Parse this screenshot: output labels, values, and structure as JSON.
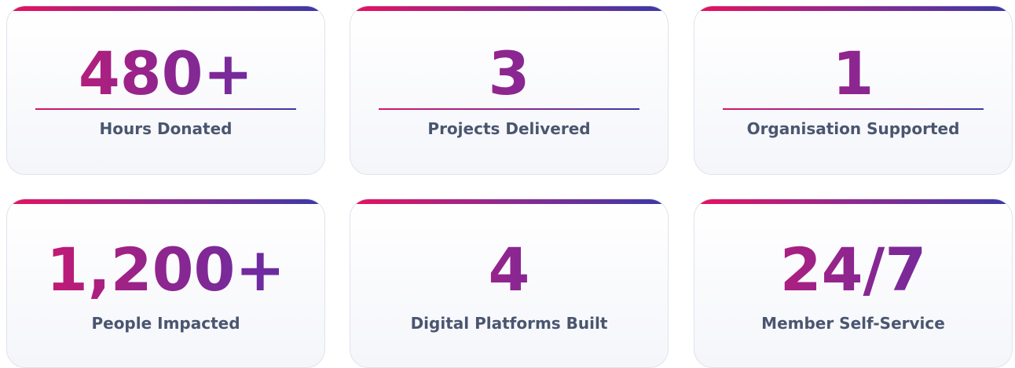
{
  "stats": [
    {
      "value": "480+",
      "label": "Hours Donated",
      "has_divider": true
    },
    {
      "value": "3",
      "label": "Projects Delivered",
      "has_divider": true
    },
    {
      "value": "1",
      "label": "Organisation Supported",
      "has_divider": true
    },
    {
      "value": "1,200+",
      "label": "People Impacted",
      "has_divider": false
    },
    {
      "value": "4",
      "label": "Digital Platforms Built",
      "has_divider": false
    },
    {
      "value": "24/7",
      "label": "Member Self-Service",
      "has_divider": false
    }
  ],
  "colors": {
    "gradient_start": "#e8115e",
    "gradient_mid": "#8e2a8f",
    "gradient_end": "#3a3aa6",
    "label_text": "#4a5670",
    "card_border": "#dfe3ec"
  }
}
